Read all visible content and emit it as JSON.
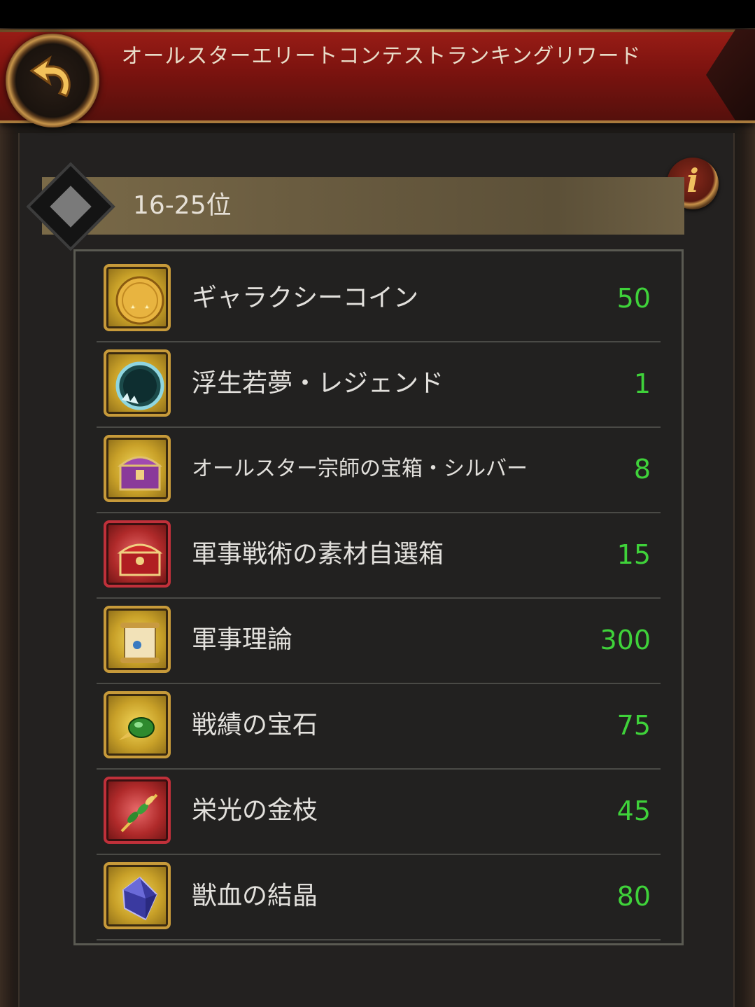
{
  "header": {
    "title": "オールスターエリートコンテストランキングリワード"
  },
  "rank": {
    "label": "16-25位"
  },
  "rewards": [
    {
      "name": "ギャラクシーコイン",
      "qty": "50",
      "icon": "galaxy-coin-icon",
      "frame": "gold"
    },
    {
      "name": "浮生若夢・レジェンド",
      "qty": "1",
      "icon": "legend-frame-icon",
      "frame": "gold"
    },
    {
      "name": "オールスター宗師の宝箱・シルバー",
      "qty": "8",
      "icon": "silver-chest-icon",
      "frame": "gold"
    },
    {
      "name": "軍事戦術の素材自選箱",
      "qty": "15",
      "icon": "material-chest-icon",
      "frame": "red"
    },
    {
      "name": "軍事理論",
      "qty": "300",
      "icon": "scroll-icon",
      "frame": "gold"
    },
    {
      "name": "戦績の宝石",
      "qty": "75",
      "icon": "green-gem-icon",
      "frame": "gold"
    },
    {
      "name": "栄光の金枝",
      "qty": "45",
      "icon": "golden-branch-icon",
      "frame": "red"
    },
    {
      "name": "獣血の結晶",
      "qty": "80",
      "icon": "crystal-icon",
      "frame": "gold"
    }
  ],
  "colors": {
    "quantity": "#3fd23a",
    "header": "#8a1712",
    "gold_frame": "#c79a3a",
    "red_frame": "#c0303a"
  }
}
